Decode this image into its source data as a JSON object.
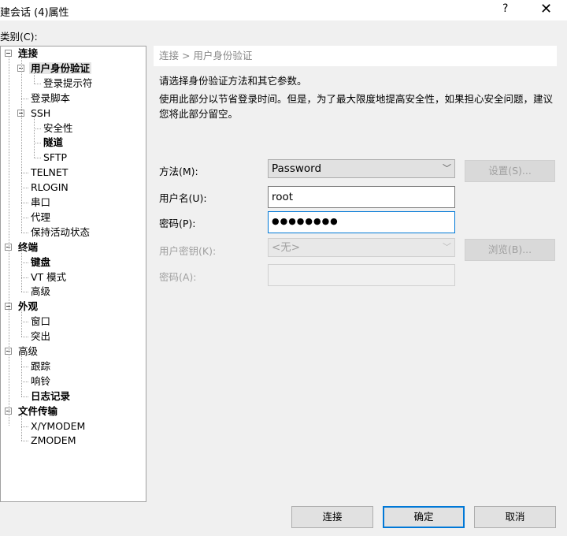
{
  "window": {
    "title": "建会话 (4)属性",
    "help": "?",
    "close": "✕"
  },
  "category_label": "类别(C):",
  "tree": [
    {
      "label": "连接",
      "level": 0,
      "bold": true,
      "expand": true
    },
    {
      "label": "用户身份验证",
      "level": 1,
      "bold": true,
      "expand": true,
      "selected": true
    },
    {
      "label": "登录提示符",
      "level": 2
    },
    {
      "label": "登录脚本",
      "level": 1
    },
    {
      "label": "SSH",
      "level": 1,
      "expand": true
    },
    {
      "label": "安全性",
      "level": 2
    },
    {
      "label": "隧道",
      "level": 2,
      "bold": true
    },
    {
      "label": "SFTP",
      "level": 2
    },
    {
      "label": "TELNET",
      "level": 1
    },
    {
      "label": "RLOGIN",
      "level": 1
    },
    {
      "label": "串口",
      "level": 1
    },
    {
      "label": "代理",
      "level": 1
    },
    {
      "label": "保持活动状态",
      "level": 1
    },
    {
      "label": "终端",
      "level": 0,
      "bold": true,
      "expand": true
    },
    {
      "label": "键盘",
      "level": 1,
      "bold": true
    },
    {
      "label": "VT 模式",
      "level": 1
    },
    {
      "label": "高级",
      "level": 1
    },
    {
      "label": "外观",
      "level": 0,
      "bold": true,
      "expand": true
    },
    {
      "label": "窗口",
      "level": 1
    },
    {
      "label": "突出",
      "level": 1
    },
    {
      "label": "高级",
      "level": 0,
      "expand": true
    },
    {
      "label": "跟踪",
      "level": 1
    },
    {
      "label": "响铃",
      "level": 1
    },
    {
      "label": "日志记录",
      "level": 1,
      "bold": true
    },
    {
      "label": "文件传输",
      "level": 0,
      "bold": true,
      "expand": true
    },
    {
      "label": "X/YMODEM",
      "level": 1
    },
    {
      "label": "ZMODEM",
      "level": 1
    }
  ],
  "breadcrumb": "连接 > 用户身份验证",
  "desc1": "请选择身份验证方法和其它参数。",
  "desc2": "使用此部分以节省登录时间。但是，为了最大限度地提高安全性，如果担心安全问题，建议您将此部分留空。",
  "form": {
    "method_label": "方法(M):",
    "method_value": "Password",
    "settings_btn": "设置(S)...",
    "user_label": "用户名(U):",
    "user_value": "root",
    "pass_label": "密码(P):",
    "pass_value": "●●●●●●●●",
    "key_label": "用户密钥(K):",
    "key_value": "<无>",
    "browse_btn": "浏览(B)...",
    "passphrase_label": "密码(A):",
    "passphrase_value": ""
  },
  "buttons": {
    "connect": "连接",
    "ok": "确定",
    "cancel": "取消"
  }
}
